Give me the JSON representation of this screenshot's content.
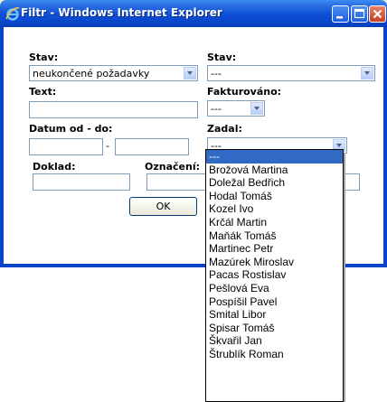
{
  "window": {
    "title": "Filtr - Windows Internet Explorer",
    "buttons": [
      "minimize",
      "maximize",
      "close"
    ]
  },
  "form": {
    "stav_left": {
      "label": "Stav:",
      "value": "neukončené požadavky"
    },
    "stav_right": {
      "label": "Stav:",
      "value": "---"
    },
    "text": {
      "label": "Text:",
      "value": ""
    },
    "fakturovano": {
      "label": "Fakturováno:",
      "value": "---"
    },
    "datum": {
      "label": "Datum od - do:",
      "separator": "-",
      "from": "",
      "to": ""
    },
    "zadal": {
      "label": "Zadal:",
      "value": "---"
    },
    "doklad": {
      "label": "Doklad:",
      "value": ""
    },
    "oznaceni": {
      "label": "Označení:",
      "value": ""
    },
    "ok_label": "OK"
  },
  "dropdown": {
    "selected_index": 0,
    "options": [
      "---",
      "Brožová Martina",
      "Doležal Bedřich",
      "Hodal Tomáš",
      "Kozel Ivo",
      "Krčál Martin",
      "Maňák Tomáš",
      "Martinec Petr",
      "Mazúrek Miroslav",
      "Pacas Rostislav",
      "Pešlová Eva",
      "Pospíšil Pavel",
      "Smital Libor",
      "Spisar Tomáš",
      "Škvařil Jan",
      "Štrublík Roman"
    ]
  },
  "colors": {
    "titlebar": "#0a45c8",
    "selection": "#316ac5"
  }
}
